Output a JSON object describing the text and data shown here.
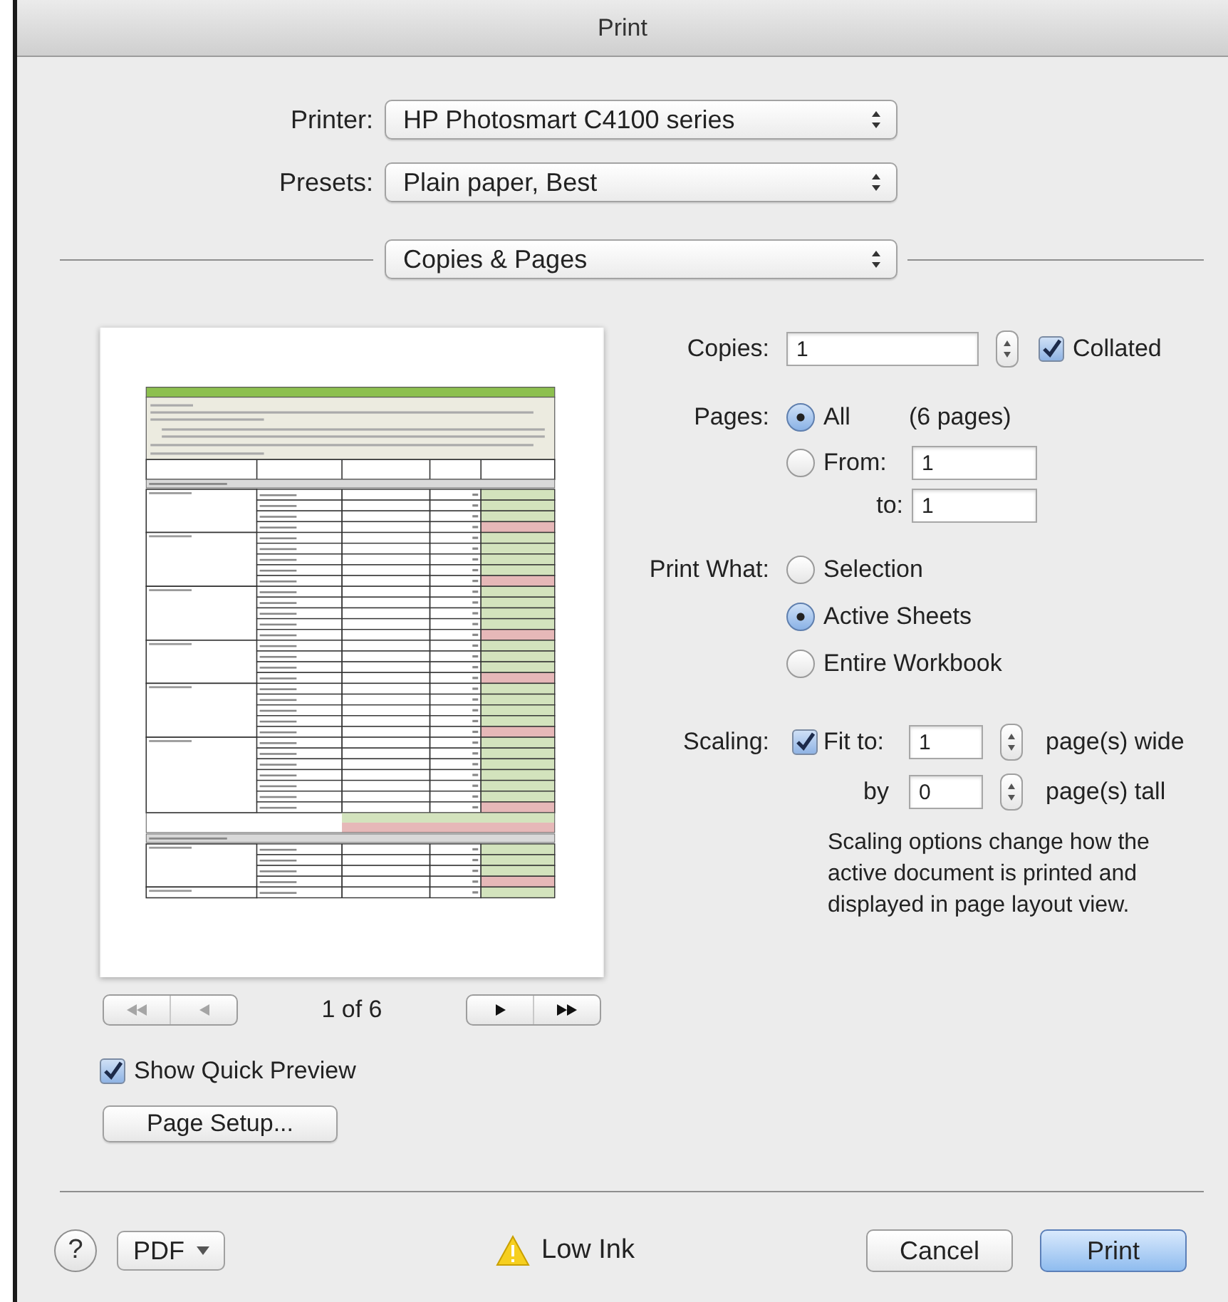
{
  "window": {
    "title": "Print"
  },
  "printer": {
    "label": "Printer:",
    "value": "HP Photosmart C4100 series"
  },
  "presets": {
    "label": "Presets:",
    "value": "Plain paper, Best"
  },
  "section": {
    "value": "Copies & Pages"
  },
  "preview": {
    "page_indicator": "1 of 6",
    "nav_buttons": [
      {
        "kind": "first",
        "disabled": true
      },
      {
        "kind": "previous",
        "disabled": true
      },
      {
        "kind": "next",
        "disabled": false
      },
      {
        "kind": "last",
        "disabled": false
      }
    ]
  },
  "show_quick_preview": {
    "label": "Show Quick Preview",
    "checked": true
  },
  "page_setup": {
    "label": "Page Setup..."
  },
  "copies": {
    "label": "Copies:",
    "value": "1",
    "collated": {
      "label": "Collated",
      "checked": true
    }
  },
  "pages": {
    "label": "Pages:",
    "options": [
      {
        "label": "All",
        "selected": true,
        "note": "(6 pages)"
      },
      {
        "label": "From:",
        "selected": false,
        "value": "1"
      }
    ],
    "to": {
      "label": "to:",
      "value": "1"
    }
  },
  "print_what": {
    "label": "Print What:",
    "options": [
      {
        "label": "Selection",
        "selected": false
      },
      {
        "label": "Active Sheets",
        "selected": true
      },
      {
        "label": "Entire Workbook",
        "selected": false
      }
    ]
  },
  "scaling": {
    "label": "Scaling:",
    "fit": {
      "label": "Fit to:",
      "checked": true,
      "value": "1",
      "unit": "page(s) wide"
    },
    "by": {
      "label": "by",
      "value": "0",
      "unit": "page(s) tall"
    },
    "note": "Scaling options change how the active document is printed and displayed in page layout view."
  },
  "footer": {
    "help": "?",
    "pdf": "PDF",
    "warning": "Low Ink",
    "buttons": [
      {
        "label": "Cancel",
        "default": false
      },
      {
        "label": "Print",
        "default": true
      }
    ]
  }
}
